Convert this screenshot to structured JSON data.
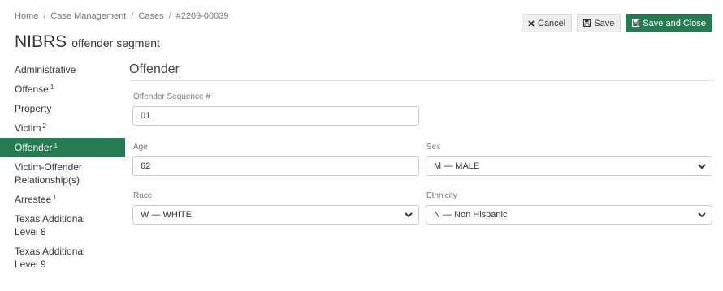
{
  "breadcrumb": [
    "Home",
    "Case Management",
    "Cases",
    "#2209-00039"
  ],
  "title": {
    "main": "NIBRS",
    "sub": "offender segment"
  },
  "actions": {
    "cancel": "Cancel",
    "save": "Save",
    "save_close": "Save and Close"
  },
  "sidebar": {
    "items": [
      {
        "label": "Administrative",
        "badge": ""
      },
      {
        "label": "Offense",
        "badge": "1"
      },
      {
        "label": "Property",
        "badge": ""
      },
      {
        "label": "Victim",
        "badge": "2"
      },
      {
        "label": "Offender",
        "badge": "1",
        "active": true
      },
      {
        "label": "Victim-Offender Relationship(s)",
        "badge": ""
      },
      {
        "label": "Arrestee",
        "badge": "1"
      },
      {
        "label": "Texas Additional Level 8",
        "badge": ""
      },
      {
        "label": "Texas Additional Level 9",
        "badge": ""
      }
    ]
  },
  "section": {
    "title": "Offender"
  },
  "form": {
    "sequence": {
      "label": "Offender Sequence #",
      "value": "01"
    },
    "age": {
      "label": "Age",
      "value": "62"
    },
    "sex": {
      "label": "Sex",
      "value": "M — MALE"
    },
    "race": {
      "label": "Race",
      "value": "W — WHITE"
    },
    "ethnicity": {
      "label": "Ethnicity",
      "value": "N — Non Hispanic"
    }
  },
  "colors": {
    "accent": "#267b50"
  }
}
